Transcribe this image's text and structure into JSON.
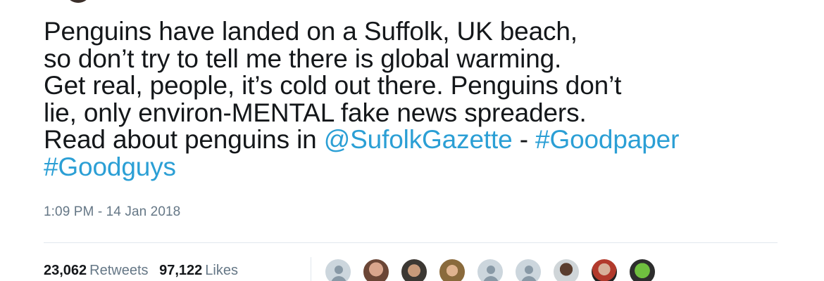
{
  "tweet": {
    "text_lines": [
      {
        "segments": [
          {
            "text": "Penguins have landed on a Suffolk, UK beach,",
            "type": "text"
          }
        ]
      },
      {
        "segments": [
          {
            "text": "so don’t try to tell me there is global warming.",
            "type": "text"
          }
        ]
      },
      {
        "segments": [
          {
            "text": "Get real, people, it’s cold out there. Penguins don’t",
            "type": "text"
          }
        ]
      },
      {
        "segments": [
          {
            "text": "lie, only environ-MENTAL fake news spreaders.",
            "type": "text"
          }
        ]
      },
      {
        "segments": [
          {
            "text": "Read about penguins in ",
            "type": "text"
          },
          {
            "text": "@SufolkGazette",
            "type": "mention"
          },
          {
            "text": " - ",
            "type": "text"
          },
          {
            "text": "#Goodpaper",
            "type": "hashtag"
          }
        ]
      },
      {
        "segments": [
          {
            "text": "#Goodguys",
            "type": "hashtag"
          }
        ]
      }
    ],
    "timestamp": "1:09 PM - 14 Jan 2018",
    "retweets": {
      "count": "23,062",
      "label": "Retweets"
    },
    "likes": {
      "count": "97,122",
      "label": "Likes"
    },
    "liker_avatars": [
      {
        "icon": "default-avatar-icon",
        "style": "default"
      },
      {
        "icon": "user-photo",
        "style": "photo-1"
      },
      {
        "icon": "user-photo",
        "style": "photo-2"
      },
      {
        "icon": "user-photo",
        "style": "photo-3"
      },
      {
        "icon": "default-avatar-icon",
        "style": "default"
      },
      {
        "icon": "default-avatar-icon",
        "style": "default"
      },
      {
        "icon": "user-photo",
        "style": "photo-4"
      },
      {
        "icon": "user-photo",
        "style": "photo-5"
      },
      {
        "icon": "user-photo",
        "style": "photo-6"
      }
    ]
  },
  "colors": {
    "text": "#14171a",
    "link": "#2b9fd5",
    "muted": "#657786",
    "divider": "#e1e8ed"
  }
}
